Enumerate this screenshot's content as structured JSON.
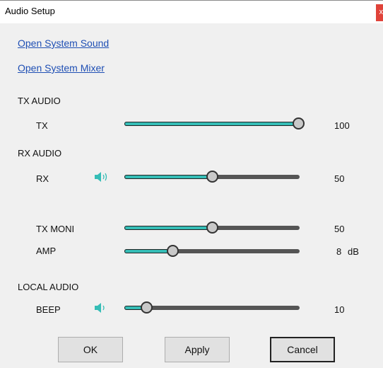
{
  "window": {
    "title": "Audio Setup",
    "close_label": "x"
  },
  "links": {
    "open_system_sound": "Open System Sound",
    "open_system_mixer": "Open System Mixer"
  },
  "sections": {
    "tx_audio": "TX AUDIO",
    "rx_audio": "RX AUDIO",
    "local_audio": "LOCAL AUDIO"
  },
  "colors": {
    "accent": "#35bdb6",
    "track": "#555555",
    "link": "#1f4fb4",
    "close": "#e0433a"
  },
  "sliders": {
    "tx": {
      "label": "TX",
      "value": 100,
      "display": "100",
      "level": 1.0
    },
    "rx": {
      "label": "RX",
      "value": 50,
      "display": "50",
      "level": 0.5,
      "icon": "speaker-icon"
    },
    "tx_moni": {
      "label": "TX MONI",
      "value": 50,
      "display": "50",
      "level": 0.5
    },
    "amp": {
      "label": "AMP",
      "value": 8,
      "display": "8",
      "unit": "dB",
      "level": 0.27
    },
    "beep": {
      "label": "BEEP",
      "value": 10,
      "display": "10",
      "level": 0.12,
      "icon": "speaker-icon"
    }
  },
  "buttons": {
    "ok": "OK",
    "apply": "Apply",
    "cancel": "Cancel"
  }
}
